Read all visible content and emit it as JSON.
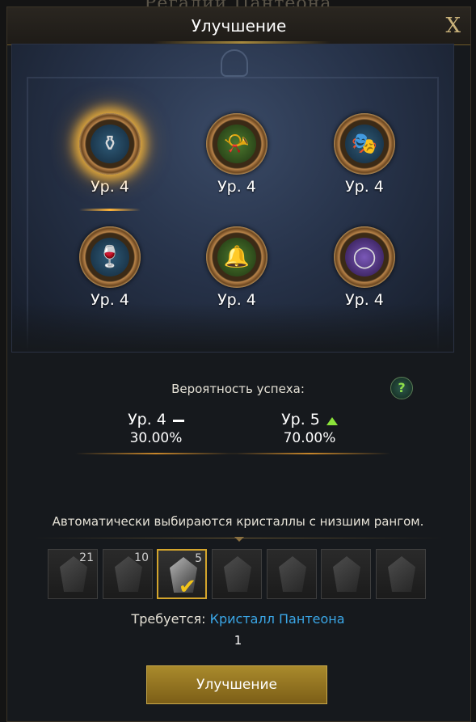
{
  "background_title": "Регалии Пантеона",
  "dialog": {
    "title": "Улучшение",
    "close_label": "X"
  },
  "items": [
    {
      "level": "Ур. 4",
      "icon": "urn-icon",
      "glyph": "⚱",
      "selected": true
    },
    {
      "level": "Ур. 4",
      "icon": "horn-icon",
      "glyph": "📯",
      "selected": false
    },
    {
      "level": "Ур. 4",
      "icon": "mask-icon",
      "glyph": "🎭",
      "selected": false
    },
    {
      "level": "Ур. 4",
      "icon": "goblet-icon",
      "glyph": "🍷",
      "selected": false
    },
    {
      "level": "Ур. 4",
      "icon": "bell-icon",
      "glyph": "🔔",
      "selected": false
    },
    {
      "level": "Ур. 4",
      "icon": "mirror-icon",
      "glyph": "◯",
      "selected": false
    }
  ],
  "probability": {
    "label": "Вероятность успеха:",
    "help": "?",
    "current": {
      "level": "Ур. 4",
      "percent": "30.00%"
    },
    "next": {
      "level": "Ур. 5",
      "percent": "70.00%"
    }
  },
  "auto_select_text": "Автоматически выбираются кристаллы с низшим рангом.",
  "crystals": [
    {
      "count": "21",
      "selected": false
    },
    {
      "count": "10",
      "selected": false
    },
    {
      "count": "5",
      "selected": true
    },
    {
      "count": "",
      "selected": false
    },
    {
      "count": "",
      "selected": false
    },
    {
      "count": "",
      "selected": false
    },
    {
      "count": "",
      "selected": false
    }
  ],
  "requirement": {
    "prefix": "Требуется:",
    "item": "Кристалл Пантеона",
    "quantity": "1"
  },
  "upgrade_button": "Улучшение",
  "colors": {
    "accent_gold": "#d4a52c",
    "link_blue": "#3aa6e6",
    "increase_green": "#8be33a"
  }
}
